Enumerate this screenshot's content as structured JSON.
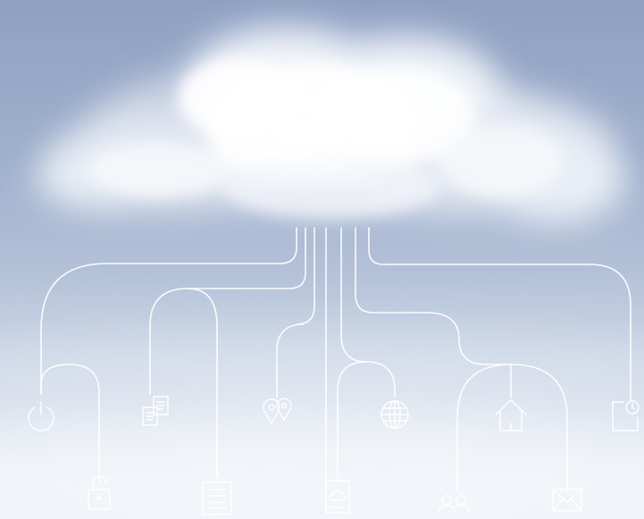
{
  "scene": {
    "description_only": false,
    "line_color": "#ffffff",
    "icons": [
      {
        "name": "power-icon"
      },
      {
        "name": "unlock-icon"
      },
      {
        "name": "documents-icon"
      },
      {
        "name": "list-document-icon"
      },
      {
        "name": "location-pins-icon"
      },
      {
        "name": "cloud-document-icon"
      },
      {
        "name": "globe-icon"
      },
      {
        "name": "home-icon"
      },
      {
        "name": "users-icon"
      },
      {
        "name": "mail-icon"
      },
      {
        "name": "clock-icon"
      }
    ]
  }
}
